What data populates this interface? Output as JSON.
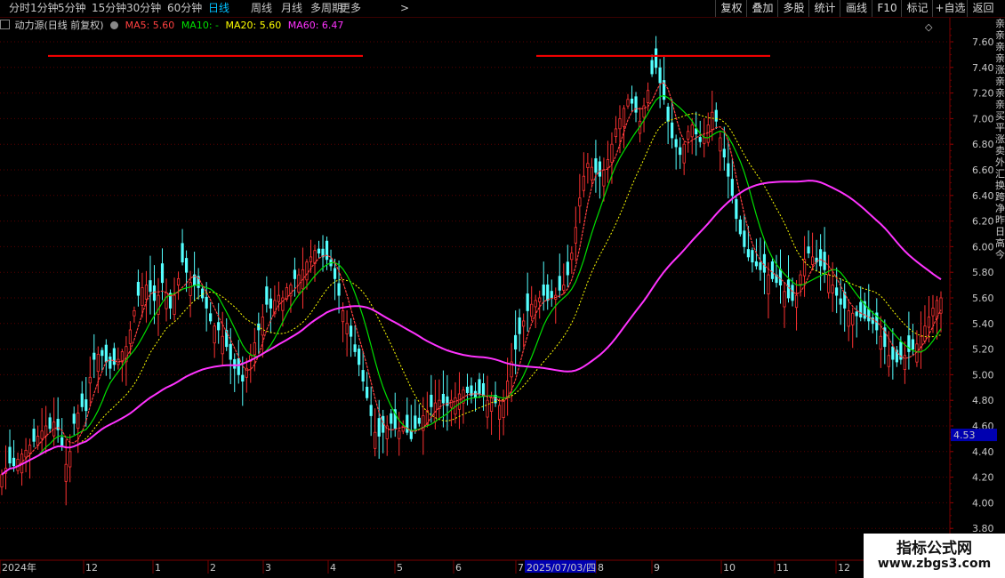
{
  "toolbar": {
    "periods": [
      "分时",
      "1分钟",
      "5分钟",
      "15分钟",
      "30分钟",
      "60分钟",
      "日线",
      "周线",
      "月线",
      "多周期",
      "更多"
    ],
    "active_period": "日线",
    "more_chevron": ">",
    "tools": [
      "复权",
      "叠加",
      "多股",
      "统计",
      "画线",
      "F10",
      "标记",
      "+自选",
      "返回"
    ]
  },
  "header": {
    "name": "动力源(日线 前复权)",
    "ma5": "MA5: 5.60",
    "ma10": "MA10: -",
    "ma20": "MA20: 5.60",
    "ma60": "MA60: 6.47",
    "diamond": "◇"
  },
  "colors": {
    "up": "#ff3232",
    "down": "#54ffff",
    "ma5": "#ff4040",
    "ma10": "#00e000",
    "ma20": "#ffff00",
    "ma60": "#ff33ff",
    "grid": "#5a0000",
    "resistance": "#ff0000"
  },
  "price_axis": {
    "ticks": [
      "7.60",
      "7.40",
      "7.20",
      "7.00",
      "6.80",
      "6.60",
      "6.40",
      "6.20",
      "6.00",
      "5.80",
      "5.60",
      "5.40",
      "5.20",
      "5.00",
      "4.80",
      "4.60",
      "4.40",
      "4.20",
      "4.00",
      "3.80"
    ],
    "current_price": "4.53"
  },
  "time_axis": {
    "labels": [
      "2024年",
      "12",
      "1",
      "2",
      "3",
      "4",
      "5",
      "6",
      "7",
      "8",
      "9",
      "10",
      "11",
      "12"
    ],
    "cursor_date": "2025/07/03/四"
  },
  "right_strip_text": "亲亲亲亲涨亲亲亲买平涨卖外汇换跨净昨日高今",
  "watermark": {
    "line1": "指标公式网",
    "line2": "www.zbgs3.com"
  },
  "chart_data": {
    "type": "candlestick",
    "title": "动力源(日线 前复权)",
    "ylim": [
      3.8,
      7.7
    ],
    "legend": [
      "MA5",
      "MA10",
      "MA20",
      "MA60"
    ],
    "ma60_last": 6.47,
    "ma5_last": 5.6,
    "ma20_last": 5.6,
    "current_price_marker": 4.53,
    "resistance_lines": [
      7.49,
      7.49
    ],
    "closes": [
      4.22,
      4.27,
      4.31,
      4.29,
      4.34,
      4.38,
      4.41,
      4.45,
      4.48,
      4.52,
      4.56,
      4.6,
      4.58,
      4.63,
      4.57,
      4.45,
      4.3,
      4.4,
      4.62,
      4.7,
      4.75,
      4.72,
      4.98,
      5.12,
      5.16,
      5.15,
      5.1,
      5.05,
      5.08,
      5.12,
      5.18,
      5.22,
      5.35,
      5.5,
      5.62,
      5.68,
      5.7,
      5.65,
      5.58,
      5.62,
      5.72,
      5.64,
      5.52,
      5.62,
      5.75,
      5.88,
      5.8,
      5.72,
      5.7,
      5.68,
      5.6,
      5.52,
      5.42,
      5.38,
      5.35,
      5.3,
      5.22,
      5.12,
      5.05,
      5.0,
      4.95,
      5.05,
      5.15,
      5.25,
      5.35,
      5.45,
      5.55,
      5.52,
      5.58,
      5.62,
      5.6,
      5.68,
      5.7,
      5.75,
      5.78,
      5.82,
      5.88,
      5.92,
      5.97,
      5.95,
      5.92,
      5.9,
      5.85,
      5.75,
      5.62,
      5.5,
      5.4,
      5.3,
      5.18,
      5.08,
      4.95,
      4.82,
      4.68,
      4.55,
      4.52,
      4.55,
      4.6,
      4.62,
      4.58,
      4.56,
      4.6,
      4.55,
      4.5,
      4.58,
      4.62,
      4.68,
      4.72,
      4.75,
      4.78,
      4.8,
      4.78,
      4.76,
      4.8,
      4.82,
      4.85,
      4.88,
      4.86,
      4.84,
      4.82,
      4.85,
      4.83,
      4.8,
      4.82,
      4.78,
      4.76,
      4.8,
      4.95,
      5.1,
      5.2,
      5.32,
      5.42,
      5.5,
      5.55,
      5.58,
      5.6,
      5.62,
      5.58,
      5.6,
      5.62,
      5.66,
      5.7,
      5.78,
      5.95,
      6.15,
      6.38,
      6.55,
      6.65,
      6.62,
      6.58,
      6.55,
      6.6,
      6.68,
      6.8,
      6.92,
      7.0,
      7.08,
      7.15,
      7.12,
      7.05,
      6.98,
      7.1,
      7.22,
      7.35,
      7.4,
      7.28,
      7.15,
      6.98,
      6.85,
      6.78,
      6.72,
      6.8,
      6.9,
      6.95,
      6.88,
      6.82,
      6.85,
      6.95,
      7.05,
      6.98,
      6.85,
      6.7,
      6.55,
      6.4,
      6.22,
      6.1,
      6.0,
      5.92,
      5.88,
      5.85,
      5.82,
      5.8,
      5.78,
      5.75,
      5.72,
      5.7,
      5.65,
      5.6,
      5.58,
      5.62,
      5.78,
      5.9,
      5.95,
      5.92,
      5.88,
      5.85,
      5.82,
      5.78,
      5.7,
      5.62,
      5.55,
      5.52,
      5.5,
      5.48,
      5.46,
      5.45,
      5.44,
      5.42,
      5.4,
      5.35,
      5.3,
      5.22,
      5.15,
      5.12,
      5.1,
      5.12,
      5.15,
      5.18,
      5.2,
      5.24,
      5.3,
      5.38,
      5.45,
      5.52,
      5.58,
      5.6
    ]
  }
}
